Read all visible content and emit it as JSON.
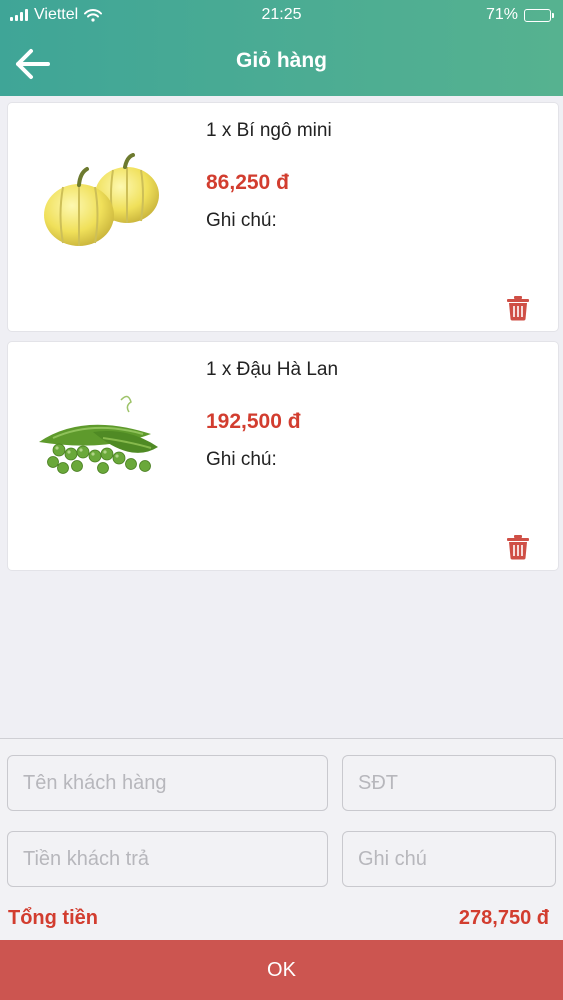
{
  "status_bar": {
    "carrier": "Viettel",
    "time": "21:25",
    "battery": "71%",
    "battery_level": 0.71
  },
  "header": {
    "title": "Giỏ hàng",
    "back_icon": "arrow-left-icon"
  },
  "cart": {
    "items": [
      {
        "name": "1 x Bí ngô mini",
        "price": "86,250 đ",
        "note_label": "Ghi chú:",
        "image": "mini-pumpkin-image",
        "delete_icon": "trash-icon"
      },
      {
        "name": "1 x Đậu Hà Lan",
        "price": "192,500 đ",
        "note_label": "Ghi chú:",
        "image": "green-peas-image",
        "delete_icon": "trash-icon"
      }
    ]
  },
  "form": {
    "customer_name_placeholder": "Tên khách hàng",
    "phone_placeholder": "SĐT",
    "paid_placeholder": "Tiền khách trả",
    "note_placeholder": "Ghi chú"
  },
  "summary": {
    "total_label": "Tổng tiền",
    "total_value": "278,750 đ"
  },
  "actions": {
    "ok_label": "OK"
  },
  "colors": {
    "header": "#4aac93",
    "accent_red": "#d23d2f",
    "ok_button": "#cc5550"
  }
}
